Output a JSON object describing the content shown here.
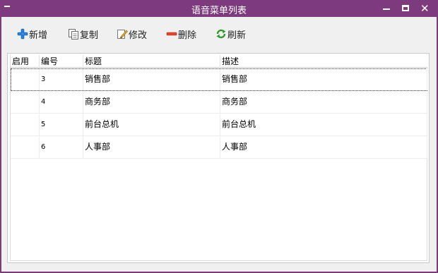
{
  "window": {
    "title": "语音菜单列表",
    "accent_color": "#7d3a7d"
  },
  "toolbar": {
    "add_label": "新增",
    "copy_label": "复制",
    "edit_label": "修改",
    "delete_label": "删除",
    "refresh_label": "刷新"
  },
  "table": {
    "columns": [
      "启用",
      "编号",
      "标题",
      "描述"
    ],
    "rows": [
      {
        "enabled": "",
        "id": "3",
        "title": "销售部",
        "desc": "销售部"
      },
      {
        "enabled": "",
        "id": "4",
        "title": "商务部",
        "desc": "商务部"
      },
      {
        "enabled": "",
        "id": "5",
        "title": "前台总机",
        "desc": "前台总机"
      },
      {
        "enabled": "",
        "id": "6",
        "title": "人事部",
        "desc": "人事部"
      }
    ]
  }
}
